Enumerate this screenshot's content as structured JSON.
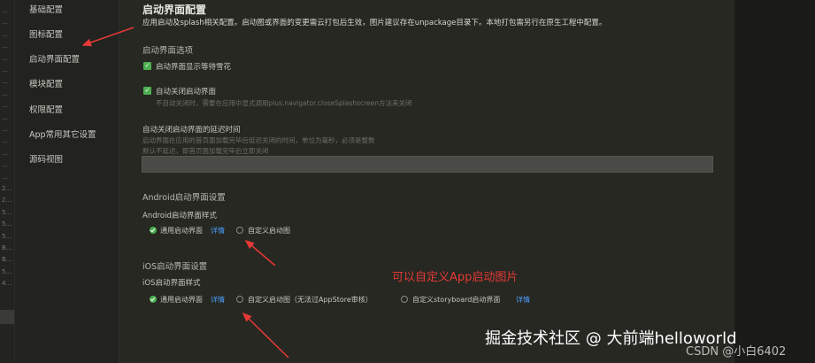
{
  "sidebar": {
    "items": [
      "基础配置",
      "图标配置",
      "启动界面配置",
      "模块配置",
      "权限配置",
      "App常用其它设置",
      "源码视图"
    ],
    "active_index": 2
  },
  "gutter": {
    "lines": [
      "…",
      "…",
      "…",
      "…",
      "…",
      "…",
      "…",
      "…",
      "…",
      "…",
      "…",
      "…",
      "…",
      "…",
      "…",
      "2…",
      "2…",
      "5…",
      "5…",
      "5…",
      "B…",
      "B…",
      "5…",
      "4…"
    ]
  },
  "main": {
    "title": "启动界面配置",
    "description": "应用启动及splash相关配置。启动图或界面的变更需云打包后生效，图片建议存在unpackage目录下。本地打包需另行在原生工程中配置。",
    "splash_options": {
      "header": "启动界面选项",
      "show_waiting": {
        "label": "启动界面显示等待雪花",
        "checked": true
      },
      "auto_close": {
        "label": "自动关闭启动界面",
        "checked": true,
        "hint": "不自动关闭时，需要在应用中显式调用plus.navigator.closeSplashscreen方法来关闭"
      },
      "delay": {
        "label": "自动关闭启动界面的延迟时间",
        "hint1": "启动界面在应用的首页面加载完毕后延迟关闭的时间，单位为毫秒，必须是整数",
        "hint2": "默认不延迟，即首页面加载完毕后立即关闭",
        "value": ""
      }
    },
    "android": {
      "header": "Android启动界面设置",
      "style_label": "Android启动界面样式",
      "opt_common": "通用启动界面",
      "detail_link": "详情",
      "opt_custom": "自定义启动图",
      "selected": "common"
    },
    "ios": {
      "header": "iOS启动界面设置",
      "style_label": "iOS启动界面样式",
      "opt_common": "通用启动界面",
      "detail_link1": "详情",
      "opt_custom": "自定义启动图（无法过AppStore审核）",
      "opt_storyboard": "自定义storyboard启动界面",
      "detail_link2": "详情",
      "selected": "common"
    }
  },
  "annotations": {
    "note": "可以自定义App启动图片",
    "color": "#e53935"
  },
  "watermarks": {
    "line1": "掘金技术社区 @ 大前端helloworld",
    "line2": "CSDN @小白6402"
  },
  "colors": {
    "checked": "#4caf50",
    "link": "#4a9eff"
  }
}
